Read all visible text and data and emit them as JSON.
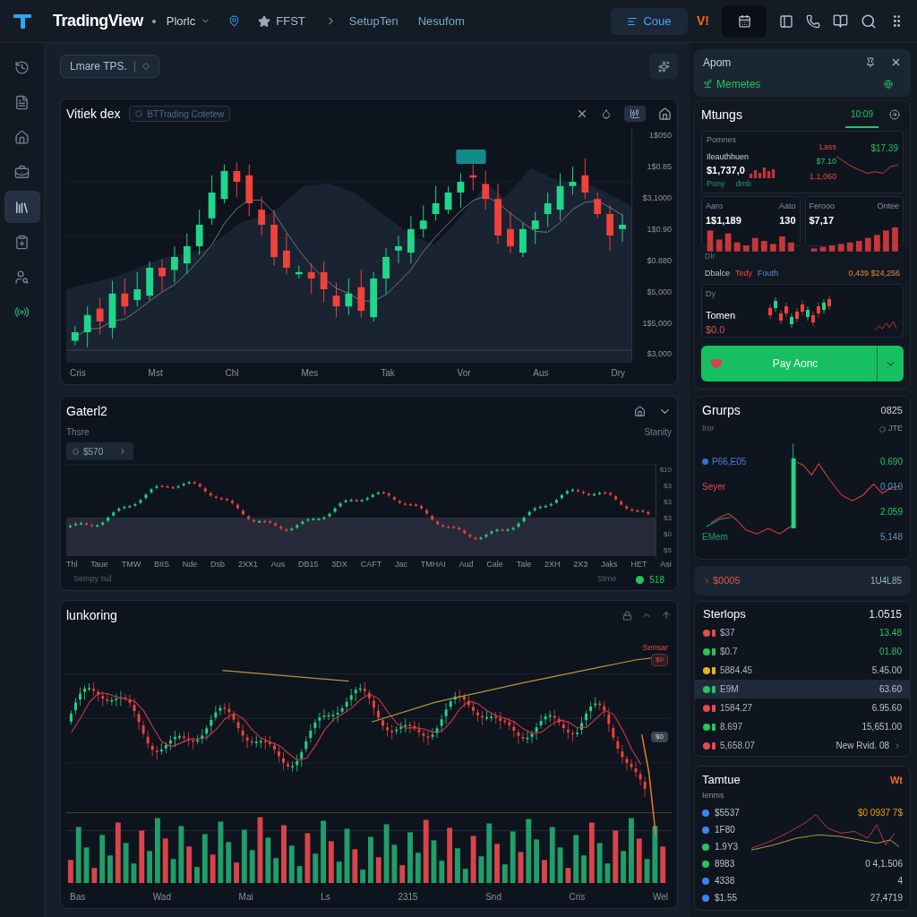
{
  "top_bar": {
    "brand": "TradingView",
    "nav": [
      {
        "label": "Plorlc",
        "kind": "dropdown"
      },
      {
        "label": "FFST",
        "kind": "starred"
      },
      {
        "label": "SetupTen",
        "kind": "link"
      },
      {
        "label": "Nesufom",
        "kind": "link"
      }
    ],
    "action_button": "Coue",
    "badge": "V!"
  },
  "sidebar": {
    "items": [
      {
        "selected": false
      },
      {
        "selected": false
      },
      {
        "selected": false
      },
      {
        "selected": false
      },
      {
        "selected": true
      },
      {
        "selected": false
      },
      {
        "selected": false
      },
      {
        "selected": false
      }
    ]
  },
  "toolbar": {
    "chip": "Lmare TPS."
  },
  "price_chart": {
    "title": "Vitiek dex",
    "symbol": "BTTrading Cotetew",
    "y_labels": [
      "1$050",
      "1$0.85",
      "$3,1000",
      "1$0.90",
      "$0.880",
      "$5,000",
      "1$5,000",
      "$3,000"
    ],
    "x_labels": [
      "Cris",
      "Mst",
      "Chl",
      "Mes",
      "Tak",
      "Vor",
      "Aus",
      "Dry"
    ]
  },
  "wave_chart": {
    "title": "Gaterl2",
    "subtitle": "Thsre",
    "right_label": "Stanity",
    "price_chip": "$570",
    "y_labels": [
      "$10",
      "$3",
      "$3",
      "$3",
      "$0",
      "$5"
    ],
    "x_labels": [
      "Thl",
      "Taue",
      "TMW",
      "BIIS",
      "Nde",
      "Dsb",
      "2XX1",
      "Aus",
      "DB15",
      "3DX",
      "CAFT",
      "Jac",
      "TMHAI",
      "Aud",
      "Cale",
      "Tale",
      "2XH",
      "2X3",
      "Jaks",
      "HET",
      "Asi"
    ],
    "footer_left": "Sempy Isd",
    "footer_right": "Stme",
    "status": {
      "text": "518",
      "color": "#22c55e"
    }
  },
  "volume_chart": {
    "title": "lunkoring",
    "tags": [
      "Sensar",
      "$0",
      "$0"
    ],
    "x_labels": [
      "Bas",
      "Wad",
      "Mai",
      "Ls",
      "2315",
      "Snd",
      "Cris",
      "Wel"
    ]
  },
  "alert_card": {
    "title": "Apom",
    "subtitle": "Memetes"
  },
  "markets_card": {
    "title": "Mtungs",
    "tabs": [
      {
        "label": "10:09",
        "selected": true
      }
    ],
    "summary": {
      "label": "Pomnes",
      "name": "Ileauthhuen",
      "value": "$1,737,0",
      "notes": [
        "Pony",
        "dmb"
      ],
      "changes": [
        {
          "text": "Lass",
          "kind": "down"
        },
        {
          "text": "$7.10",
          "kind": "up"
        },
        {
          "text": "1.1,060",
          "kind": "down"
        }
      ],
      "price": "$17.39"
    },
    "tiles": [
      {
        "labels": [
          "Aaro",
          "Aato"
        ],
        "values": [
          "1$1,189",
          "130"
        ]
      },
      {
        "labels": [
          "Ferooo",
          "Ontee"
        ],
        "values": [
          "$7,17"
        ]
      }
    ],
    "flow": {
      "label": "Dlr",
      "items": [
        {
          "text": "Dbalce",
          "kind": "flat"
        },
        {
          "text": "Tedy",
          "kind": "down"
        },
        {
          "text": "Fouth",
          "kind": "info"
        }
      ],
      "value": "0,439 $24,256"
    },
    "ticker": {
      "label": "Dy",
      "name": "Tomen",
      "value": "$0.0"
    }
  },
  "trade_button": {
    "label": "Pay Aonc"
  },
  "groups_card": {
    "title": "Grurps",
    "value": "0825",
    "note": "tror",
    "tag": "JTE",
    "rows": [
      {
        "label": "P66,E05",
        "kind": "primary",
        "dot": true,
        "color": "#3b6fd8",
        "value": "0.690"
      },
      {
        "label": "Seyer",
        "kind": "alert",
        "dot": false,
        "value": "0.010"
      },
      {
        "kind": "plain",
        "dot": false,
        "value": "2.059"
      },
      {
        "label": "EMem",
        "kind": "accent",
        "dot": false,
        "value": "5,148"
      }
    ]
  },
  "total_row": {
    "label": "$0005",
    "value": "1U4L85"
  },
  "stops_card": {
    "title": "Sterlops",
    "value": "1.0515",
    "rows": [
      {
        "name": "$37",
        "value": "13.48",
        "color": "#e5484d",
        "kind": "up",
        "selected": false
      },
      {
        "name": "$0.7",
        "value": "01.80",
        "color": "#22c55e",
        "kind": "up",
        "selected": false
      },
      {
        "name": "5884.45",
        "value": "5.45.00",
        "color": "#eab308",
        "kind": "flat",
        "selected": false
      },
      {
        "name": "E9M",
        "value": "63.60",
        "color": "#22c55e",
        "kind": "flat",
        "selected": true
      },
      {
        "name": "1584.27",
        "value": "6.95.60",
        "color": "#e5484d",
        "kind": "flat",
        "selected": false
      },
      {
        "name": "8.697",
        "value": "15,651.00",
        "color": "#22c55e",
        "kind": "flat",
        "selected": false
      },
      {
        "name": "5,658.07",
        "value": "New Rvid. 08",
        "color": "#e5484d",
        "kind": "flat",
        "selected": false
      }
    ]
  },
  "tape_card": {
    "title": "Tamtue",
    "badge": "Wt",
    "subtitle": "Ienms",
    "rows": [
      {
        "name": "$5537",
        "color": "#3b82f6",
        "value": "$0 0937 7$",
        "kind": "alert"
      },
      {
        "name": "1F80",
        "color": "#3b82f6"
      },
      {
        "name": "1.9Y3",
        "color": "#22c55e"
      },
      {
        "name": "8983",
        "color": "#22c55e",
        "value": "0 4,1.506",
        "kind": "flat"
      },
      {
        "name": "4338",
        "color": "#3b82f6",
        "value": "4",
        "kind": "flat"
      },
      {
        "name": "$1.55",
        "color": "#3b82f6",
        "value": "27,4719",
        "kind": "flat"
      }
    ]
  }
}
